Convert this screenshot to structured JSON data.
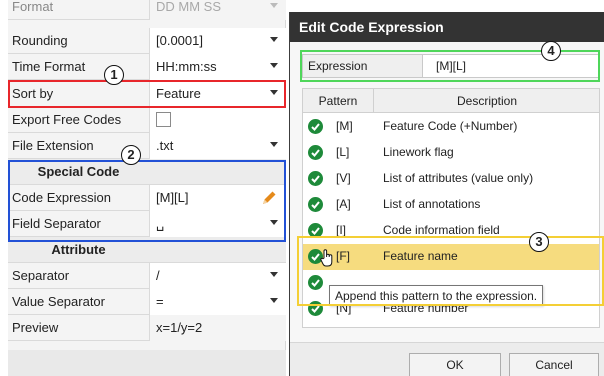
{
  "properties": {
    "rows": [
      {
        "label": "Format",
        "value": "DD MM SS"
      },
      {
        "label": "Rounding",
        "value": "[0.0001]"
      },
      {
        "label": "Time Format",
        "value": "HH:mm:ss"
      },
      {
        "label": "Sort by",
        "value": "Feature"
      },
      {
        "label": "Export Free Codes",
        "value": ""
      },
      {
        "label": "File Extension",
        "value": ".txt"
      }
    ],
    "special_code": {
      "heading": "Special Code",
      "code_expression": {
        "label": "Code Expression",
        "value": "[M][L]"
      },
      "field_separator": {
        "label": "Field Separator",
        "value": "␣"
      }
    },
    "attribute": {
      "heading": "Attribute",
      "separator": {
        "label": "Separator",
        "value": "/"
      },
      "value_separator": {
        "label": "Value Separator",
        "value": "="
      },
      "preview": {
        "label": "Preview",
        "value": "x=1/y=2"
      }
    }
  },
  "dialog": {
    "title": "Edit Code Expression",
    "expression": {
      "label": "Expression",
      "value": "[M][L]"
    },
    "table": {
      "headers": {
        "pattern": "Pattern",
        "description": "Description"
      },
      "rows": [
        {
          "pattern": "[M]",
          "description": "Feature Code (+Number)"
        },
        {
          "pattern": "[L]",
          "description": "Linework flag"
        },
        {
          "pattern": "[V]",
          "description": "List of attributes (value only)"
        },
        {
          "pattern": "[A]",
          "description": "List of annotations"
        },
        {
          "pattern": "[I]",
          "description": "Code information field"
        },
        {
          "pattern": "[F]",
          "description": "Feature name"
        },
        {
          "pattern": "",
          "description": ""
        },
        {
          "pattern": "[N]",
          "description": "Feature number"
        }
      ]
    },
    "tooltip": "Append this pattern to the expression.",
    "ok_label": "OK",
    "cancel_label": "Cancel"
  },
  "callouts": [
    "1",
    "2",
    "3",
    "4"
  ],
  "colors": {
    "callout_1": "#e8262b",
    "callout_2": "#2251d6",
    "callout_3": "#f4cf35",
    "callout_4": "#4fd65a",
    "selected_row": "#f6dc7f",
    "title_bar": "#333333",
    "pattern_icon": "#1e8a3a",
    "pencil": "#e58a1b"
  },
  "icons": [
    "dropdown-arrow-icon",
    "pencil-icon",
    "add-pattern-icon",
    "hand-cursor-icon"
  ]
}
